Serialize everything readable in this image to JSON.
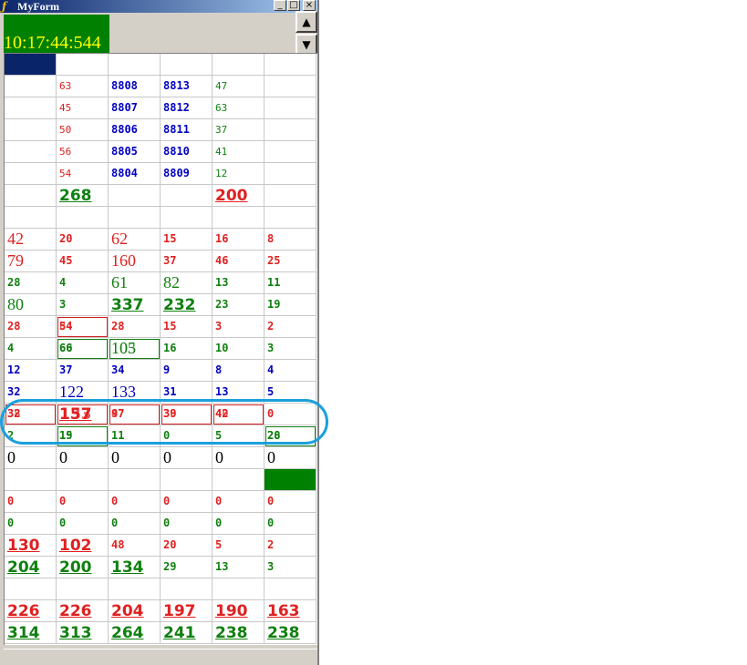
{
  "window": {
    "title": "MyForm"
  },
  "titlebar": {
    "icon": "app-icon",
    "min_label": "_",
    "max_label": "□",
    "close_label": "×"
  },
  "clock": {
    "time": "10:17:44:544",
    "bg_color": "#008000",
    "fg_color": "#ffff00"
  },
  "scroll": {
    "up_label": "▲",
    "down_label": "▼"
  },
  "annotation_color": "#1aa0dc",
  "grid": {
    "rows": [
      [
        "",
        "",
        "",
        "",
        "",
        ""
      ],
      [
        "",
        "63",
        "8808",
        "8813",
        "47",
        ""
      ],
      [
        "",
        "45",
        "8807",
        "8812",
        "63",
        ""
      ],
      [
        "",
        "50",
        "8806",
        "8811",
        "37",
        ""
      ],
      [
        "",
        "56",
        "8805",
        "8810",
        "41",
        ""
      ],
      [
        "",
        "54",
        "8804",
        "8809",
        "12",
        ""
      ],
      [
        "",
        "268",
        "",
        "",
        "200",
        ""
      ],
      [
        "",
        "",
        "",
        "",
        "",
        ""
      ],
      [
        "42",
        "20",
        "62",
        "15",
        "16",
        "8"
      ],
      [
        "79",
        "45",
        "160",
        "37",
        "46",
        "25"
      ],
      [
        "28",
        "4",
        "61",
        "82",
        "13",
        "11"
      ],
      [
        "80",
        "3",
        "337",
        "232",
        "23",
        "19"
      ],
      [
        "28",
        "54",
        "28",
        "15",
        "3",
        "2"
      ],
      [
        "4",
        "66",
        "105",
        "16",
        "10",
        "3"
      ],
      [
        "12",
        "37",
        "34",
        "9",
        "8",
        "4"
      ],
      [
        "32",
        "122",
        "133",
        "31",
        "13",
        "5"
      ],
      [
        "32",
        "157",
        "97",
        "39",
        "42",
        "0"
      ],
      [
        "2",
        "19",
        "11",
        "0",
        "5",
        "28"
      ],
      [
        "0",
        "0",
        "0",
        "0",
        "0",
        "0"
      ],
      [
        "",
        "",
        "",
        "",
        "",
        ""
      ],
      [
        "0",
        "0",
        "0",
        "0",
        "0",
        "0"
      ],
      [
        "0",
        "0",
        "0",
        "0",
        "0",
        "0"
      ],
      [
        "130",
        "102",
        "48",
        "20",
        "5",
        "2"
      ],
      [
        "204",
        "200",
        "134",
        "29",
        "13",
        "3"
      ],
      [
        "",
        "",
        "",
        "",
        "",
        ""
      ],
      [
        "226",
        "226",
        "204",
        "197",
        "190",
        "163"
      ],
      [
        "314",
        "313",
        "264",
        "241",
        "238",
        "238"
      ]
    ],
    "overlaps": {
      "r12c1": "84",
      "r13c1": "60",
      "r13c2": "103",
      "r16c0": "38",
      "r16c1": "133",
      "r16c2": "47",
      "r16c3": "30",
      "r16c4": "40",
      "r17c1": "15",
      "r17c5": "20"
    }
  }
}
